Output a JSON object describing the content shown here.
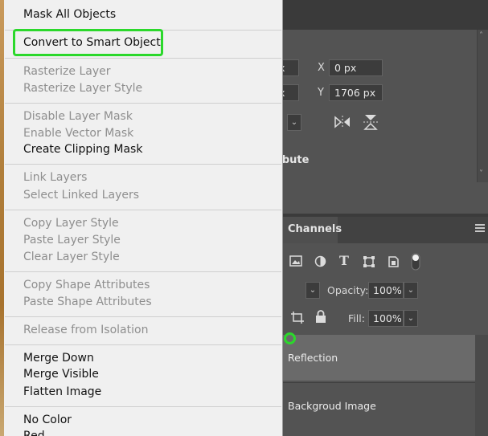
{
  "menu": {
    "items": [
      {
        "label": "Mask All Objects",
        "enabled": true
      },
      {
        "label": "Convert to Smart Object",
        "enabled": true,
        "highlighted": true
      },
      {
        "label": "Rasterize Layer",
        "enabled": false
      },
      {
        "label": "Rasterize Layer Style",
        "enabled": false
      },
      {
        "label": "Disable Layer Mask",
        "enabled": false
      },
      {
        "label": "Enable Vector Mask",
        "enabled": false
      },
      {
        "label": "Create Clipping Mask",
        "enabled": true
      },
      {
        "label": "Link Layers",
        "enabled": false
      },
      {
        "label": "Select Linked Layers",
        "enabled": false
      },
      {
        "label": "Copy Layer Style",
        "enabled": false
      },
      {
        "label": "Paste Layer Style",
        "enabled": false
      },
      {
        "label": "Clear Layer Style",
        "enabled": false
      },
      {
        "label": "Copy Shape Attributes",
        "enabled": false
      },
      {
        "label": "Paste Shape Attributes",
        "enabled": false
      },
      {
        "label": "Release from Isolation",
        "enabled": false
      },
      {
        "label": "Merge Down",
        "enabled": true
      },
      {
        "label": "Merge Visible",
        "enabled": true
      },
      {
        "label": "Flatten Image",
        "enabled": true
      },
      {
        "label": "No Color",
        "enabled": true
      },
      {
        "label": "Red",
        "enabled": true
      }
    ]
  },
  "properties": {
    "x_label": "X",
    "x_value": "0 px",
    "y_label": "Y",
    "y_value": "1706 px",
    "w_unit": "x",
    "h_unit": "x",
    "distribute_label": "ribute"
  },
  "layers_panel": {
    "tab_label": "Channels",
    "opacity_label": "Opacity:",
    "opacity_value": "100%",
    "fill_label": "Fill:",
    "fill_value": "100%",
    "layers": [
      {
        "name": "Reflection",
        "selected": true
      },
      {
        "name": "Backgroud Image",
        "selected": false
      }
    ]
  },
  "colors": {
    "highlight_outline": "#2bd82b",
    "menu_bg": "#f0f0f0",
    "panel_bg": "#535353"
  }
}
